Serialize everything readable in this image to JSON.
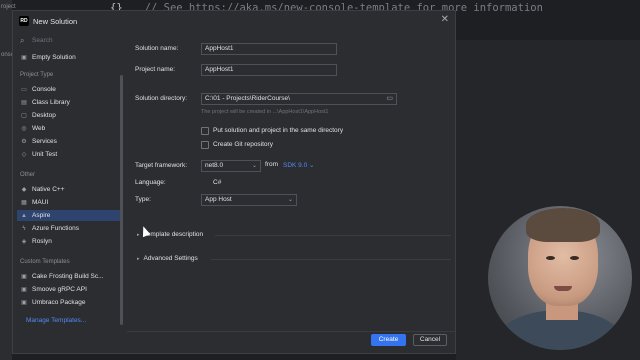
{
  "background": {
    "left_labels": [
      "roject",
      "onso"
    ],
    "code_brace": "{}",
    "code_comment": "// See https://aka.ms/new-console-template for more information"
  },
  "dialog": {
    "logo_text": "RD",
    "title": "New Solution",
    "close_symbol": "✕"
  },
  "sidebar": {
    "search_placeholder": "Search",
    "items_top": [
      {
        "label": "Empty Solution",
        "icon": "solution-icon"
      }
    ],
    "section_project_type": "Project Type",
    "project_types": [
      {
        "label": "Console",
        "icon": "console-icon"
      },
      {
        "label": "Class Library",
        "icon": "class-library-icon"
      },
      {
        "label": "Desktop",
        "icon": "desktop-icon"
      },
      {
        "label": "Web",
        "icon": "web-icon"
      },
      {
        "label": "Services",
        "icon": "services-icon"
      },
      {
        "label": "Unit Test",
        "icon": "unit-test-icon"
      }
    ],
    "section_other": "Other",
    "other_types": [
      {
        "label": "Native C++",
        "icon": "cpp-icon"
      },
      {
        "label": "MAUI",
        "icon": "maui-icon"
      },
      {
        "label": "Aspire",
        "icon": "aspire-icon",
        "active": true
      },
      {
        "label": "Azure Functions",
        "icon": "azure-functions-icon"
      },
      {
        "label": "Roslyn",
        "icon": "roslyn-icon"
      }
    ],
    "section_custom": "Custom Templates",
    "custom_templates": [
      {
        "label": "Cake Frosting Build Sc...",
        "icon": "cake-icon"
      },
      {
        "label": "Smoove gRPC API",
        "icon": "grpc-icon"
      },
      {
        "label": "Umbraco Package",
        "icon": "umbraco-icon"
      }
    ],
    "manage_link": "Manage Templates..."
  },
  "form": {
    "solution_name_label": "Solution name:",
    "solution_name_value": "AppHost1",
    "project_name_label": "Project name:",
    "project_name_value": "AppHost1",
    "solution_dir_label": "Solution directory:",
    "solution_dir_value": "C:\\01 - Projects\\RiderCourse\\",
    "dir_hint": "The project will be created in ...\\AppHost1\\AppHost1",
    "checkbox_same_dir": "Put solution and project in the same directory",
    "checkbox_git": "Create Git repository",
    "framework_label": "Target framework:",
    "framework_value": "net8.0",
    "from_label": "from",
    "sdk_value": "SDK 9.0",
    "language_label": "Language:",
    "language_value": "C#",
    "type_label": "Type:",
    "type_value": "App Host",
    "template_description": "Template description",
    "advanced_settings": "Advanced Settings"
  },
  "footer": {
    "create_label": "Create",
    "cancel_label": "Cancel"
  },
  "colors": {
    "accent": "#3574f0",
    "link": "#548af7",
    "active_item": "#2e436e",
    "dialog_bg": "#2b2d30"
  }
}
